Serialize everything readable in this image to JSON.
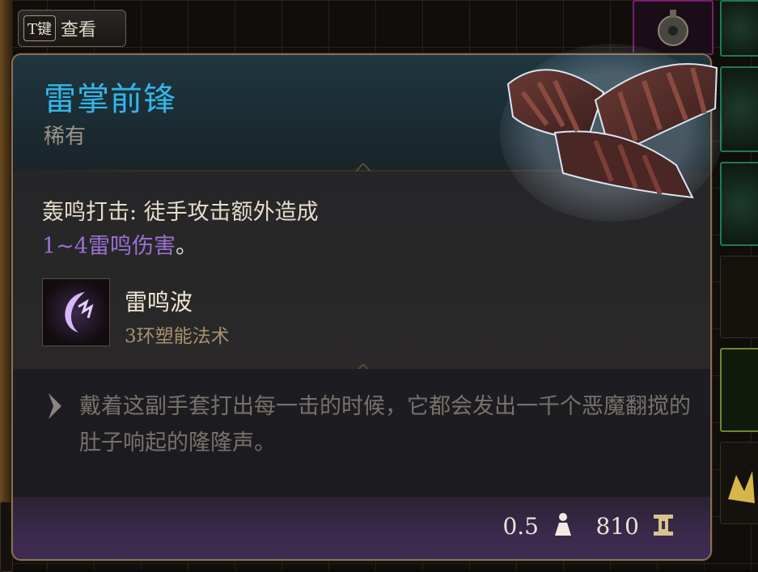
{
  "key_hint": {
    "key": "T键",
    "label": "查看"
  },
  "item": {
    "name": "雷掌前锋",
    "rarity": "稀有",
    "passive": {
      "text": "轰鸣打击: 徒手攻击额外造成",
      "damage": "1~4雷鸣伤害",
      "tail": "。"
    },
    "spell": {
      "name": "雷鸣波",
      "subtitle": "3环塑能法术",
      "icon": "thunderwave-icon"
    },
    "lore": "戴着这副手套打出每一击的时候，它都会发出一千个恶魔翻搅的肚子响起的隆隆声。",
    "weight": "0.5",
    "value": "810"
  },
  "colors": {
    "name": "#33b6e8",
    "damage": "#9a70d0",
    "rarity": "#9d9488",
    "border": "#8a7050",
    "footer": "#3e2b52"
  },
  "icons": [
    "weight-icon",
    "gold-icon",
    "lore-chevron-icon",
    "gloves-art-icon"
  ]
}
